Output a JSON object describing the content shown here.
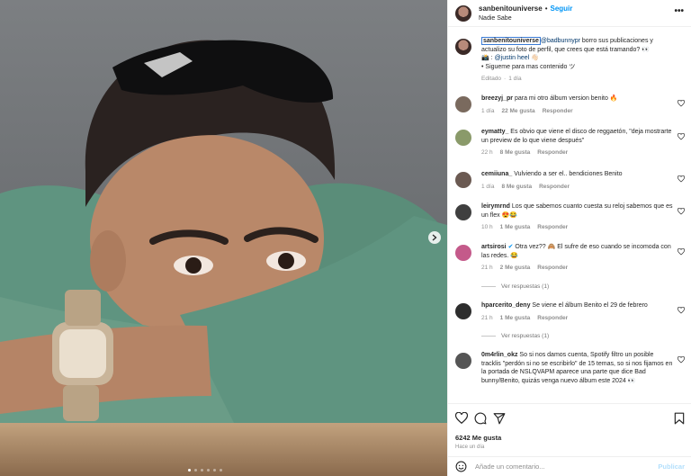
{
  "post": {
    "photo_count": 6,
    "active_photo": 1
  },
  "header": {
    "username": "sanbenitouniverse",
    "bullet": "•",
    "follow_label": "Seguir",
    "subtitle": "Nadie Sabe",
    "more_label": "•••"
  },
  "caption": {
    "username": "sanbenitouniverse",
    "mention": "@badbunnypr",
    "text": " borro sus publicaciones y actualizo su foto de perfil, que crees que está tramando? 👀",
    "line2_prefix": "📸 : ",
    "line2_mention": "@justin heel",
    "line2_suffix": " 👋🏻",
    "line3": "• Siguеme para mas contenido ツ",
    "edited": "Editado",
    "dot": "·",
    "time": "1 día"
  },
  "comments": [
    {
      "user": "breezyj_pr",
      "text": " para mi otro álbum version benito 🔥",
      "time": "1 día",
      "likes": "22 Me gusta",
      "reply": "Responder",
      "avatar_color": "#7a6a5e"
    },
    {
      "user": "eymatty_",
      "text": " Es obvio que viene el disco de reggaetón, \"deja mostrarte un preview de lo que viene después\"",
      "time": "22 h",
      "likes": "8 Me gusta",
      "reply": "Responder",
      "avatar_color": "#8a9a6a"
    },
    {
      "user": "cemiiuna_",
      "text": " Vulviendo a ser el.. bendiciones Benito",
      "time": "1 día",
      "likes": "8 Me gusta",
      "reply": "Responder",
      "avatar_color": "#6b5a52"
    },
    {
      "user": "leirymrnd",
      "text": " Los que sabemos cuanto cuesta su reloj sabemos que es un flex 😍😂",
      "time": "10 h",
      "likes": "1 Me gusta",
      "reply": "Responder",
      "avatar_color": "#3f3f3f"
    },
    {
      "user": "artsirosi",
      "verified": "✔",
      "text": " Otra vez?? 🙈 El sufre de eso cuando se incomoda con las redes. 😂",
      "time": "21 h",
      "likes": "2 Me gusta",
      "reply": "Responder",
      "avatar_color": "#c45a8a"
    },
    {
      "user": "hparcerito_deny",
      "text": " Se viene el álbum Benito el 29 de febrero",
      "time": "21 h",
      "likes": "1 Me gusta",
      "reply": "Responder",
      "avatar_color": "#2d2d2d"
    },
    {
      "user": "0m4rlin_okz",
      "text": " So si nos damos cuenta, Spotify filtro un posible tracklis \"perdón si no se escribirlo\" de 15 temas, so si nos fijamos en la portada de NSLQVAPM aparece una parte que dice Bad bunny/Benito, quizás venga nuevo álbum este 2024 👀",
      "time": "",
      "likes": "",
      "reply": "",
      "avatar_color": "#555555"
    }
  ],
  "replies_label": "Ver respuestas (1)",
  "actions": {
    "likes": "6242 Me gusta",
    "time_ago": "Hace un día"
  },
  "add_comment": {
    "placeholder": "Añade un comentario...",
    "publish": "Publicar"
  },
  "colors": {
    "accent": "#0095f6",
    "publish_disabled": "#b2dffc",
    "shirt": "#6a9c87"
  }
}
